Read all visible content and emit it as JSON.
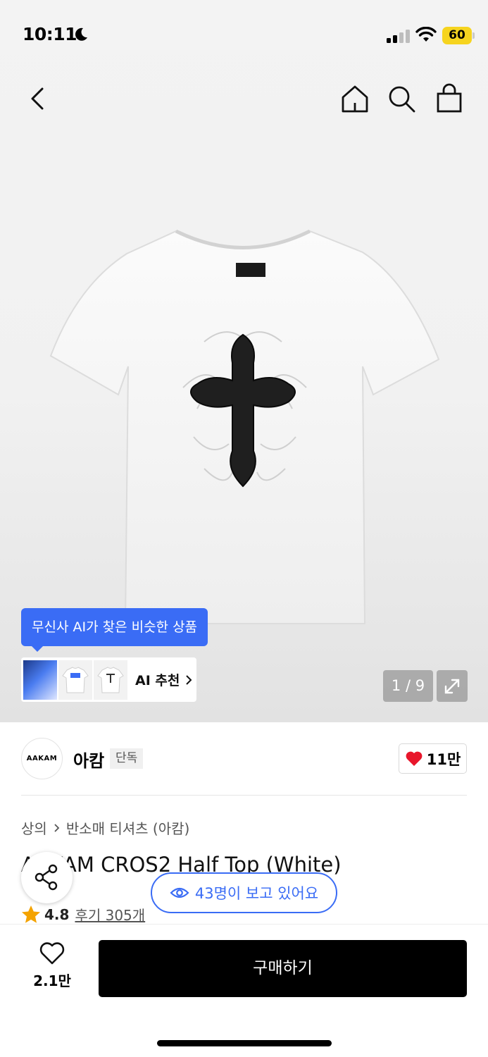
{
  "status_bar": {
    "time": "10:11",
    "battery": "60"
  },
  "gallery": {
    "counter": "1 / 9"
  },
  "ai_recommend": {
    "tooltip": "무신사 AI가 찾은 비슷한 상품",
    "label": "AI 추천"
  },
  "brand": {
    "logo_text": "AAKAM",
    "name": "아캄",
    "badge": "단독",
    "likes": "11만"
  },
  "product": {
    "breadcrumb": [
      "상의",
      "반소매 티셔츠 (아캄)"
    ],
    "title": "AAKAM CROS2 Half Top (White)",
    "rating": "4.8",
    "reviews": "후기 305개",
    "viewing": "43명이 보고 있어요"
  },
  "bottom_bar": {
    "wish_count": "2.1만",
    "buy_label": "구매하기"
  },
  "colors": {
    "accent": "#3a6cf5",
    "like_red": "#e8162b",
    "star": "#f4a300",
    "battery": "#f6d41f"
  }
}
